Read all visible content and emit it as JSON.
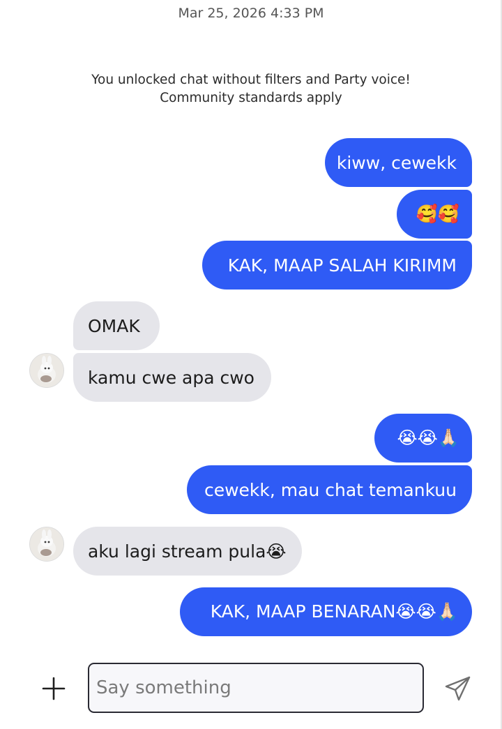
{
  "chat": {
    "timestamp": "Mar 25, 2026 4:33 PM",
    "system_line1": "You unlocked chat without filters and Party voice!",
    "system_line2": "Community standards apply"
  },
  "messages": [
    {
      "from": "me",
      "text": "kiww, cewekk"
    },
    {
      "from": "me",
      "text": "🥰🥰"
    },
    {
      "from": "me",
      "text": "KAK, MAAP SALAH KIRIMM"
    },
    {
      "from": "them",
      "text": "OMAK"
    },
    {
      "from": "them",
      "text": "kamu cwe apa cwo"
    },
    {
      "from": "me",
      "text": "😭😭🙏🏻"
    },
    {
      "from": "me",
      "text": "cewekk, mau chat temankuu"
    },
    {
      "from": "them",
      "text": "aku lagi stream pula😭"
    },
    {
      "from": "me",
      "text": "KAK, MAAP BENARAN😭😭🙏🏻"
    }
  ],
  "composer": {
    "placeholder": "Say something",
    "value": ""
  },
  "colors": {
    "outgoing_bubble": "#2f5bf5",
    "incoming_bubble": "#e5e5ea"
  },
  "icons": {
    "add": "plus-icon",
    "send": "paper-plane-icon",
    "avatar": "user-avatar"
  }
}
